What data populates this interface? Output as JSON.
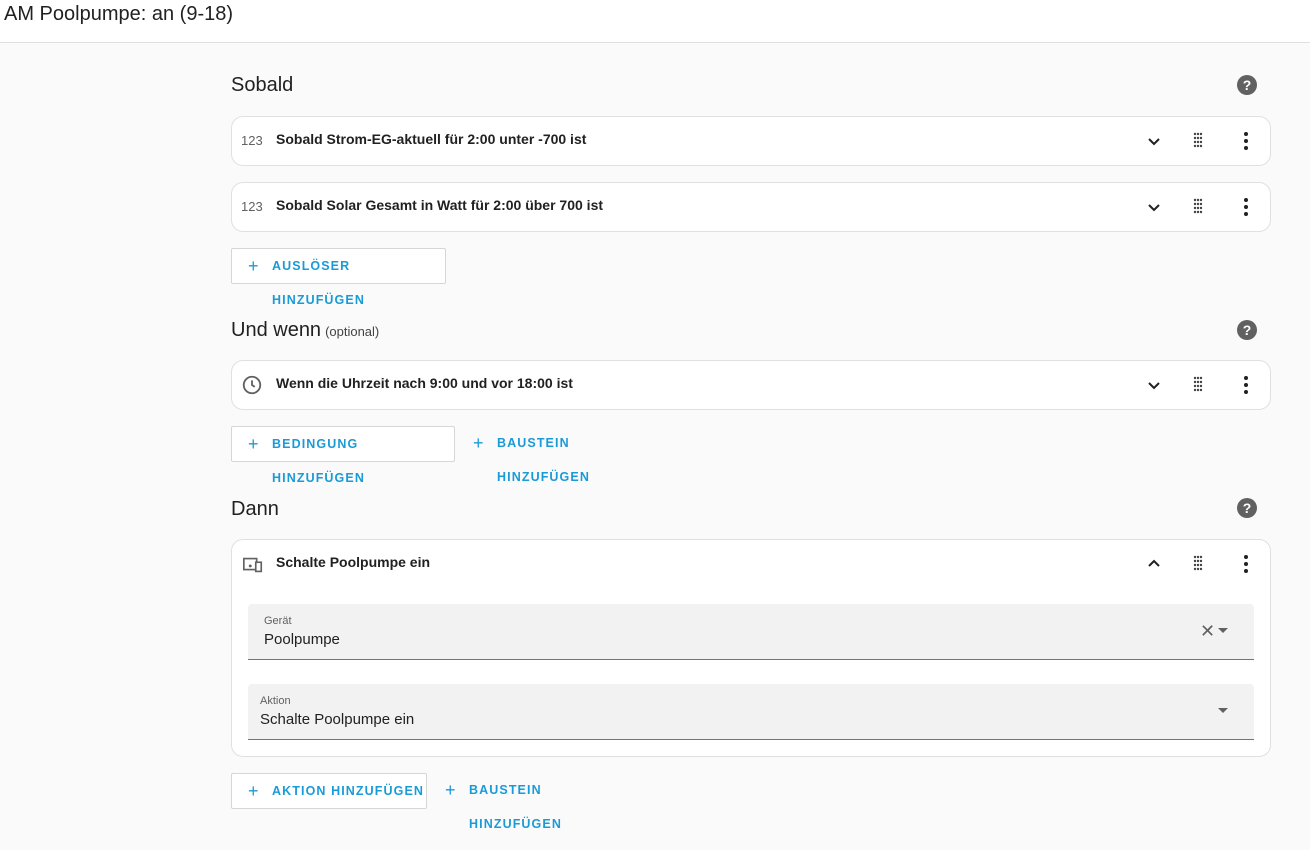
{
  "header": {
    "title": "AM Poolpumpe: an (9-18)"
  },
  "triggers": {
    "title": "Sobald",
    "items": [
      {
        "icon": "numeric-icon",
        "icon_text": "123",
        "label": "Sobald Strom-EG-aktuell für 2:00 unter -700 ist"
      },
      {
        "icon": "numeric-icon",
        "icon_text": "123",
        "label": "Sobald Solar Gesamt in Watt für 2:00 über 700 ist"
      }
    ],
    "add_label": "AUSLÖSER HINZUFÜGEN"
  },
  "conditions": {
    "title": "Und wenn",
    "optional": "(optional)",
    "items": [
      {
        "icon": "clock-icon",
        "label": "Wenn die Uhrzeit nach 9:00 und vor 18:00 ist"
      }
    ],
    "add_label": "BEDINGUNG HINZUFÜGEN",
    "add_block_label": "BAUSTEIN HINZUFÜGEN"
  },
  "actions": {
    "title": "Dann",
    "items": [
      {
        "icon": "devices-icon",
        "label": "Schalte Poolpumpe ein",
        "expanded": true,
        "fields": [
          {
            "label": "Gerät",
            "value": "Poolpumpe",
            "clearable": true
          },
          {
            "label": "Aktion",
            "value": "Schalte Poolpumpe ein",
            "clearable": false
          }
        ]
      }
    ],
    "add_label": "AKTION HINZUFÜGEN",
    "add_block_label": "BAUSTEIN HINZUFÜGEN"
  },
  "icons": {
    "help": "help-icon",
    "expand": "chevron-down-icon",
    "collapse": "chevron-up-icon",
    "drag": "drag-handle-icon",
    "menu": "dots-vertical-icon",
    "add": "plus-icon",
    "clear": "close-icon",
    "dropdown": "menu-down-icon"
  },
  "help_glyph": "?",
  "plus_glyph": "+",
  "clear_glyph": "✕",
  "colors": {
    "accent": "#1a9bd7",
    "icon": "#616161",
    "card_border": "#e0e0e0",
    "background": "#fafafa"
  }
}
